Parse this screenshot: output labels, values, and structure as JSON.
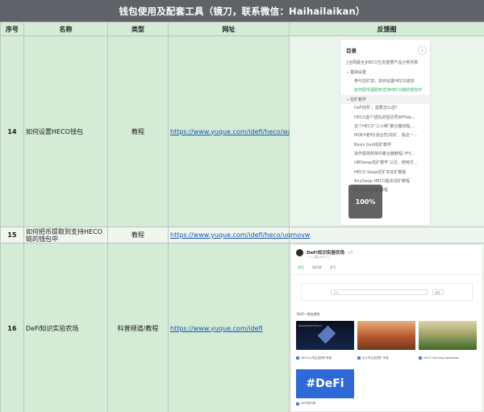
{
  "title": "钱包使用及配套工具（镜刀，联系微信：Haihailaikan）",
  "columns": [
    "序号",
    "名称",
    "类型",
    "网址",
    "反馈图"
  ],
  "rows": [
    {
      "num": "14",
      "name": "如何设置HECO钱包",
      "type": "教程",
      "url": "https://www.yuque.com/idefi/heco/wallet"
    },
    {
      "num": "15",
      "name": "如何把币提取到支持HECO链的钱包中",
      "type": "教程",
      "url": "https://www.yuque.com/idefi/heco/uqmovw"
    },
    {
      "num": "16",
      "name": "DeFi知识实验农场",
      "type": "科普频道/教程",
      "url": "https://www.yuque.com/idefi"
    }
  ],
  "toc": {
    "title": "目录",
    "collapse_icon": "‹",
    "items": [
      "[全网最全]HECO生态重要产品分类列表",
      "基础设置",
      "参与挖矿前，如何设置HECO钱包",
      "如何把币提取到支持HECO链的钱包中",
      "挖矿教学",
      "DeFi挖矿，需要怎么选？",
      "HECO首个团队的借贷项目Filda...",
      "这个HECO“三小稀”聚合器流程...",
      "MDEX者利(混合性)挖矿、看这一...",
      "Basis Gold挖矿教学",
      "操作极简简单的聚合器教程-YFII...",
      "UBISwap挖矿教学 1(注、使用方...",
      "HECO Swap挖矿本挖矿教程",
      "AnySwap HECO版本挖矿教程",
      "HT Swap挖矿教程"
    ],
    "zoom": "100%"
  },
  "site": {
    "name": "DeFi知识实验农场",
    "badge": "公开",
    "subtitle": "一个门槛DeFi入门",
    "tabs": [
      "首页",
      "知识库",
      "关于"
    ],
    "search_placeholder": "搜索",
    "search_button": "搜索",
    "section": "DeFi一进去就挖",
    "cards": [
      {
        "label": "HECO火币生态挖矿专卷"
      },
      {
        "label": "在火币生态挖矿 专卷"
      },
      {
        "label": "HECO Farming Handbook"
      }
    ],
    "banner_text": "#DeFi",
    "banner_label": "DeFi知识库",
    "card1_caption": "Decentralized Finance"
  }
}
